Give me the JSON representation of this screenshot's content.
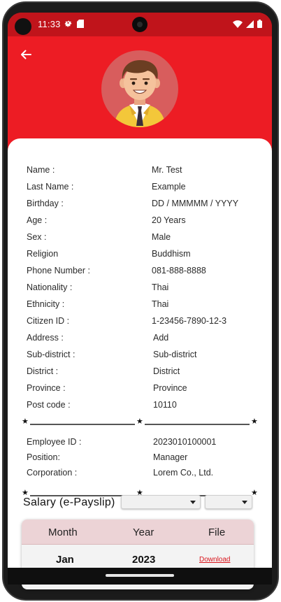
{
  "status_bar": {
    "time": "11:33"
  },
  "profile": [
    {
      "label": "Name :",
      "value": "Mr. Test"
    },
    {
      "label": "Last Name :",
      "value": "Example"
    },
    {
      "label": "Birthday :",
      "value": "DD / MMMMM / YYYY"
    },
    {
      "label": "Age :",
      "value": "20 Years"
    },
    {
      "label": "Sex :",
      "value": "Male"
    },
    {
      "label": "Religion",
      "value": "Buddhism"
    },
    {
      "label": "Phone Number :",
      "value": "081-888-8888"
    },
    {
      "label": "Nationality :",
      "value": "Thai"
    },
    {
      "label": "Ethnicity :",
      "value": "Thai"
    },
    {
      "label": "Citizen ID :",
      "value": "1-23456-7890-12-3"
    },
    {
      "label": "Address :",
      "value": "Add"
    },
    {
      "label": "Sub-district :",
      "value": "Sub-district"
    },
    {
      "label": "District :",
      "value": "District"
    },
    {
      "label": "Province :",
      "value": "Province"
    },
    {
      "label": "Post code :",
      "value": "10110"
    }
  ],
  "employment": [
    {
      "label": "Employee ID :",
      "value": "2023010100001"
    },
    {
      "label": "Position:",
      "value": "Manager"
    },
    {
      "label": "Corporation :",
      "value": "Lorem Co., Ltd."
    }
  ],
  "salary": {
    "title": "Salary (e-Payslip)",
    "month_select_value": "",
    "year_select_value": "",
    "table": {
      "headers": [
        "Month",
        "Year",
        "File"
      ],
      "rows": [
        {
          "month": "Jan",
          "year": "2023",
          "file": "Download"
        }
      ]
    }
  },
  "divider_glyph": "★",
  "colors": {
    "primary": "#ed1c24",
    "status_bar": "#c0141b",
    "link": "#d9141b",
    "table_header": "#ecd3d6"
  },
  "icons": [
    "back-arrow-icon",
    "settings-gear-icon",
    "sd-card-icon",
    "wifi-icon",
    "signal-icon",
    "battery-icon",
    "dropdown-caret-icon"
  ]
}
